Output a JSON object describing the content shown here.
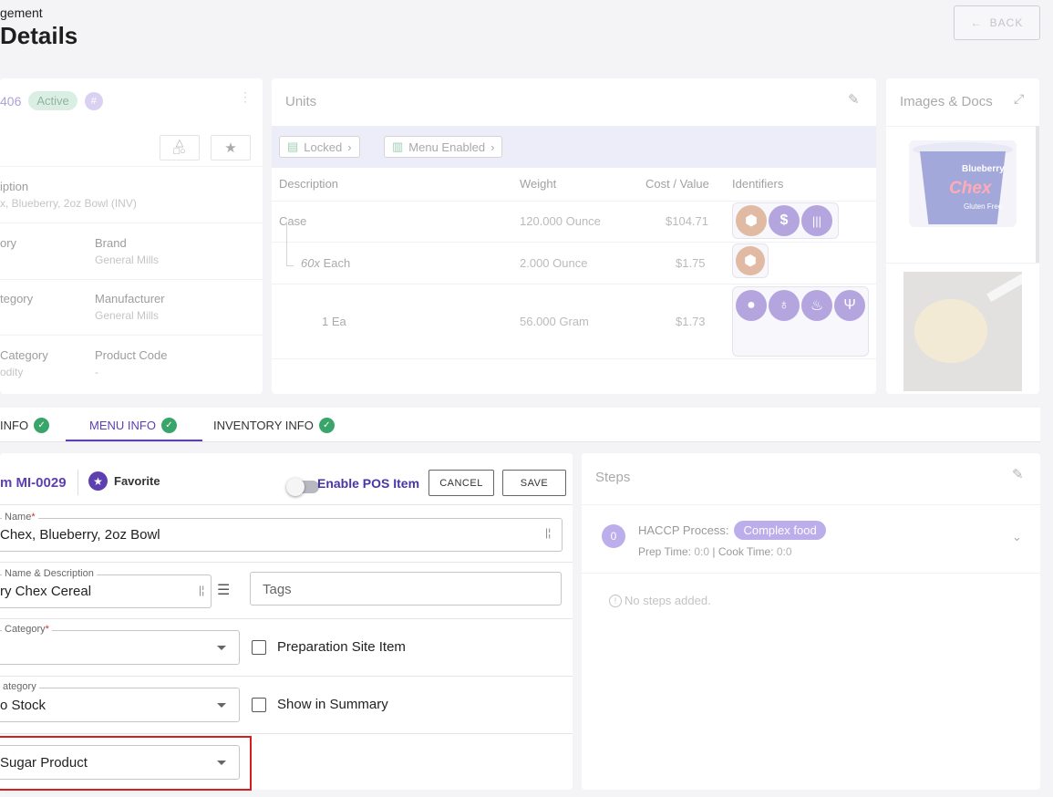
{
  "header": {
    "subtitle": "gement",
    "title": "Details",
    "back_label": "BACK"
  },
  "item_card": {
    "code": "406",
    "status": "Active",
    "hash": "#",
    "fields": {
      "description_label": "iption",
      "description_value": "x, Blueberry, 2oz Bowl (INV)",
      "category_label": "ory",
      "brand_label": "Brand",
      "brand_value": "General Mills",
      "subcategory_label": "tegory",
      "manufacturer_label": "Manufacturer",
      "manufacturer_value": "General Mills",
      "cat3_label": "Category",
      "cat3_value": "odity",
      "product_code_label": "Product Code",
      "product_code_value": "-"
    }
  },
  "units": {
    "title": "Units",
    "locked_label": "Locked",
    "menu_enabled_label": "Menu Enabled",
    "headers": {
      "description": "Description",
      "weight": "Weight",
      "cost": "Cost / Value",
      "identifiers": "Identifiers"
    },
    "rows": [
      {
        "desc": "Case",
        "weight": "120.000 Ounce",
        "cost": "$104.71"
      },
      {
        "desc_prefix": "60x",
        "desc": "Each",
        "weight": "2.000 Ounce",
        "cost": "$1.75"
      },
      {
        "desc": "1 Ea",
        "weight": "56.000 Gram",
        "cost": "$1.73"
      }
    ]
  },
  "images": {
    "title": "Images & Docs",
    "product_brand": "Blueberry",
    "product_name": "Chex",
    "product_tag": "Gluten Free"
  },
  "tabs": [
    {
      "label": "INFO"
    },
    {
      "label": "MENU INFO"
    },
    {
      "label": "INVENTORY INFO"
    }
  ],
  "menu_form": {
    "item_id": "m MI-0029",
    "favorite_label": "Favorite",
    "pos_label": "Enable POS Item",
    "cancel_label": "CANCEL",
    "save_label": "SAVE",
    "name_label": "Name",
    "name_value": "Chex, Blueberry, 2oz Bowl",
    "name_desc_label": "Name & Description",
    "name_desc_value": "ry Chex Cereal",
    "tags_placeholder": "Tags",
    "category_label": "Category",
    "category_value": "",
    "prep_site_label": "Preparation Site Item",
    "category2_label": "ategory",
    "category2_value": "o Stock",
    "summary_label": "Show in Summary",
    "sugar_value": "Sugar Product"
  },
  "steps": {
    "title": "Steps",
    "step_number": "0",
    "haccp_label": "HACCP Process:",
    "haccp_value": "Complex food",
    "prep_label": "Prep Time:",
    "prep_value": "0:0",
    "separator": "|",
    "cook_label": "Cook Time:",
    "cook_value": "0:0",
    "empty_label": "No steps added."
  }
}
